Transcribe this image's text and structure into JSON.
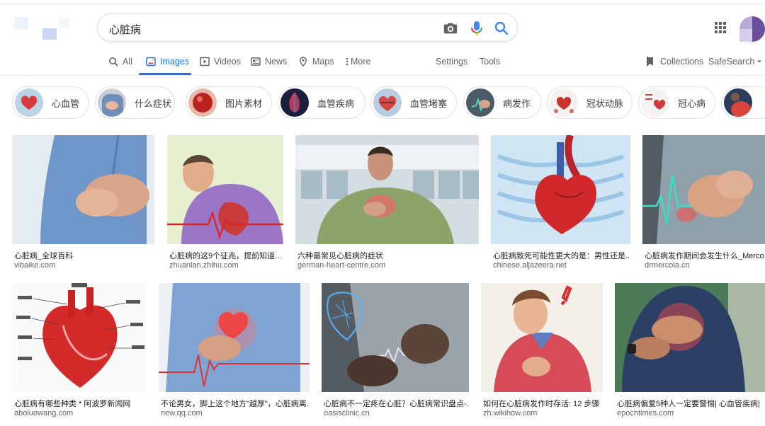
{
  "search": {
    "query": "心脏病"
  },
  "tabs": [
    {
      "label": "All",
      "icon": "search-icon"
    },
    {
      "label": "Images",
      "icon": "image-icon",
      "active": true
    },
    {
      "label": "Videos",
      "icon": "video-icon"
    },
    {
      "label": "News",
      "icon": "news-icon"
    },
    {
      "label": "Maps",
      "icon": "map-pin-icon"
    },
    {
      "label": "More",
      "icon": "more-vert-icon"
    }
  ],
  "tools": {
    "settings": "Settings",
    "tools": "Tools",
    "collections": "Collections",
    "safesearch": "SafeSearch"
  },
  "chips": [
    {
      "label": "心血管"
    },
    {
      "label": "什么症状"
    },
    {
      "label": "图片素材"
    },
    {
      "label": "血管疾病"
    },
    {
      "label": "血管堵塞"
    },
    {
      "label": "病发作"
    },
    {
      "label": "冠状动脉"
    },
    {
      "label": "冠心病"
    }
  ],
  "results": [
    {
      "title": "心脏病_全球百科",
      "source": "vibaike.com"
    },
    {
      "title": "心脏病的这9个征兆，提前知道...",
      "source": "zhuanlan.zhihu.com"
    },
    {
      "title": "六种最常见心脏病的症状",
      "source": "german-heart-centre.com"
    },
    {
      "title": "心脏病致死可能性更大的是：男性还是...",
      "source": "chinese.aljazeera.net"
    },
    {
      "title": "心脏病发作期间会发生什么_Merco...",
      "source": "drmercola.cn"
    },
    {
      "title": "心脏病有哪些种类 * 阿波罗新闻网",
      "source": "aboluowang.com"
    },
    {
      "title": "不论男女，脚上这个地方\"越厚\"，心脏病离...",
      "source": "new.qq.com"
    },
    {
      "title": "心脏病不一定疼在心脏？心脏病常识盘点-...",
      "source": "oasisclinic.cn"
    },
    {
      "title": "如何在心脏病发作时存活: 12 步骤",
      "source": "zh.wikihow.com"
    },
    {
      "title": "心脏病偏爱5种人一定要警惕| 心血管疾病|",
      "source": "epochtimes.com"
    }
  ],
  "colors": {
    "accent": "#1a73e8",
    "heart_red": "#d9302b",
    "text": "#202124",
    "muted": "#5f6368"
  }
}
